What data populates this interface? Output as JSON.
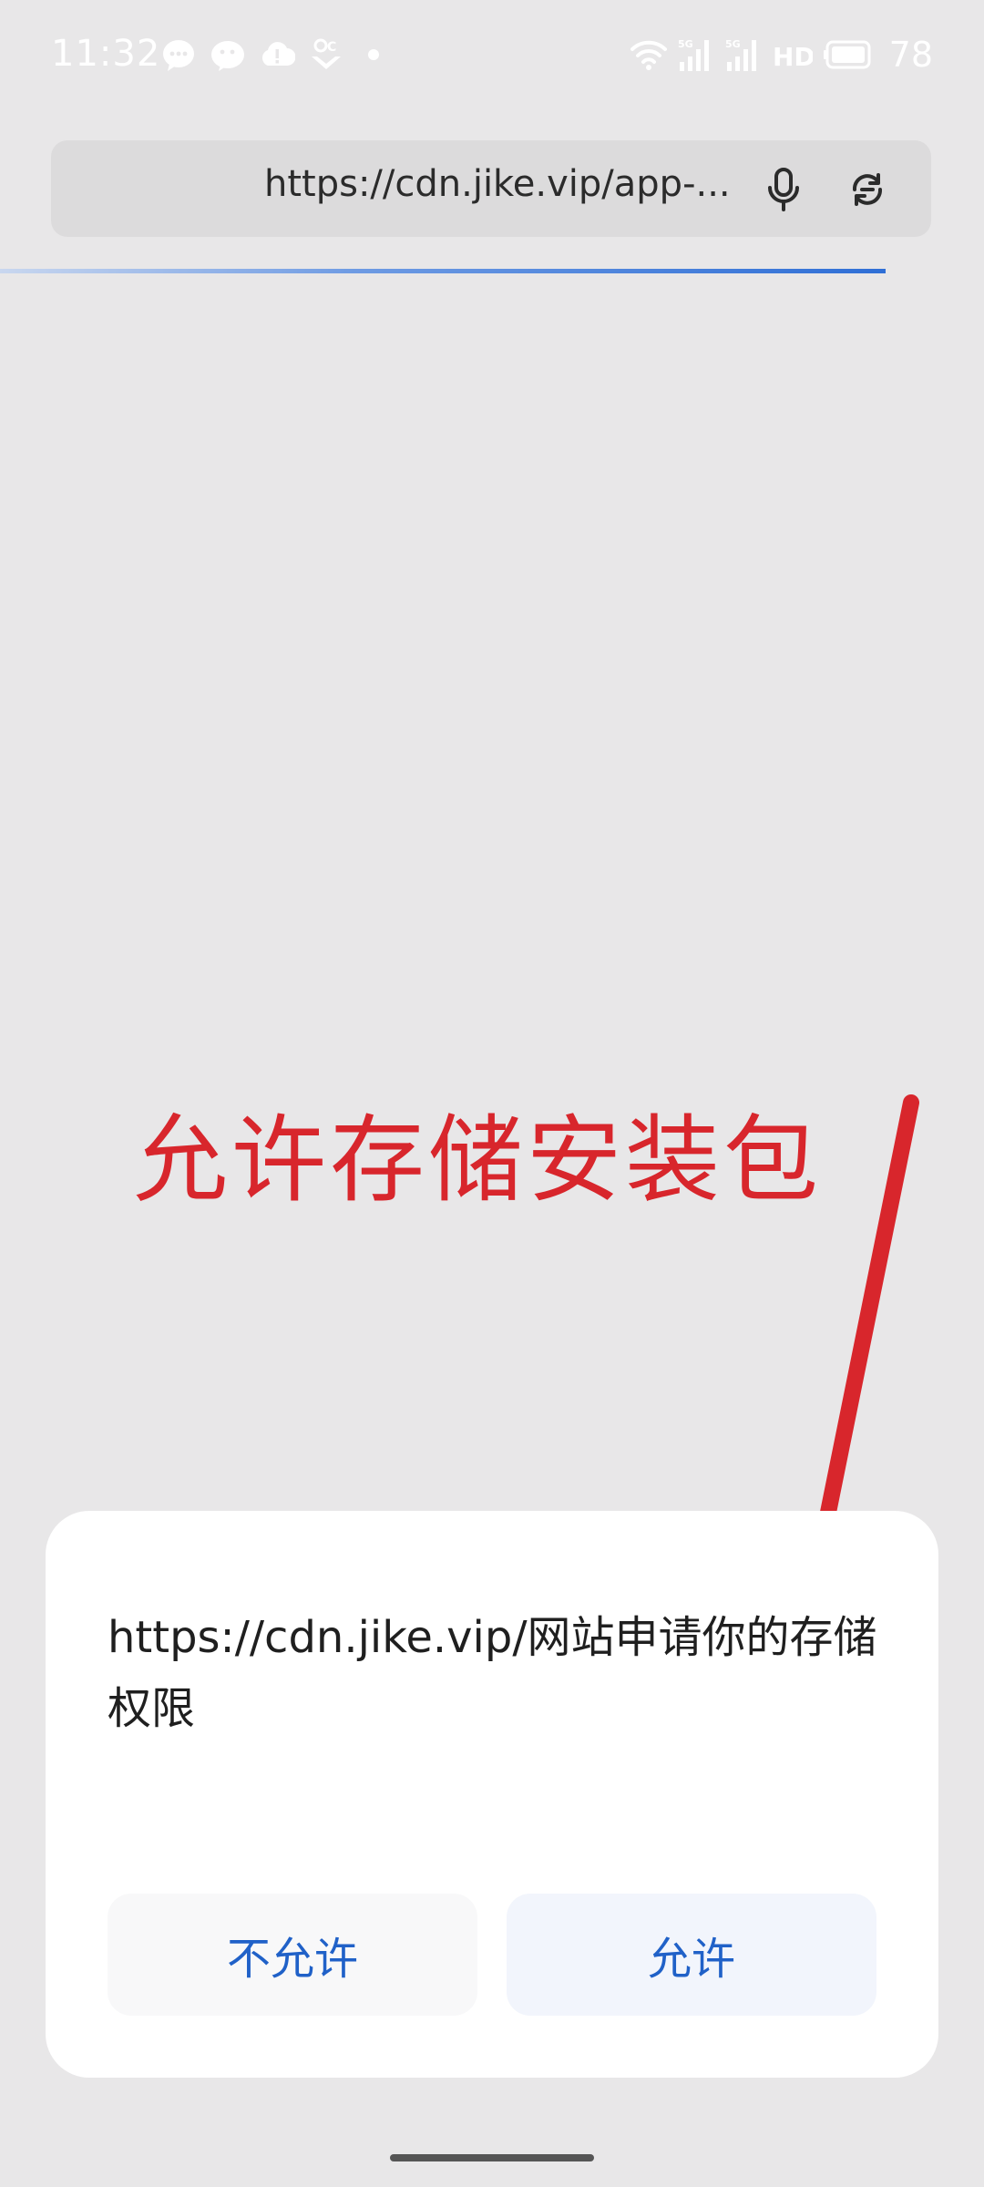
{
  "status_bar": {
    "time": "11:32",
    "battery_level": "78",
    "icons": [
      "message-icon",
      "wechat-icon",
      "cloud-icon",
      "weather-icon",
      "wifi-icon",
      "signal-5g-icon",
      "signal-icon",
      "hd-icon",
      "battery-icon"
    ]
  },
  "browser": {
    "url": "https://cdn.jike.vip/app-...",
    "load_progress": 0.9
  },
  "annotation": {
    "text": "允许存储安装包",
    "color": "#d8262c"
  },
  "dialog": {
    "message": "https://cdn.jike.vip/网站申请你的存储权限",
    "deny_label": "不允许",
    "allow_label": "允许",
    "button_text_color": "#2061c8"
  }
}
